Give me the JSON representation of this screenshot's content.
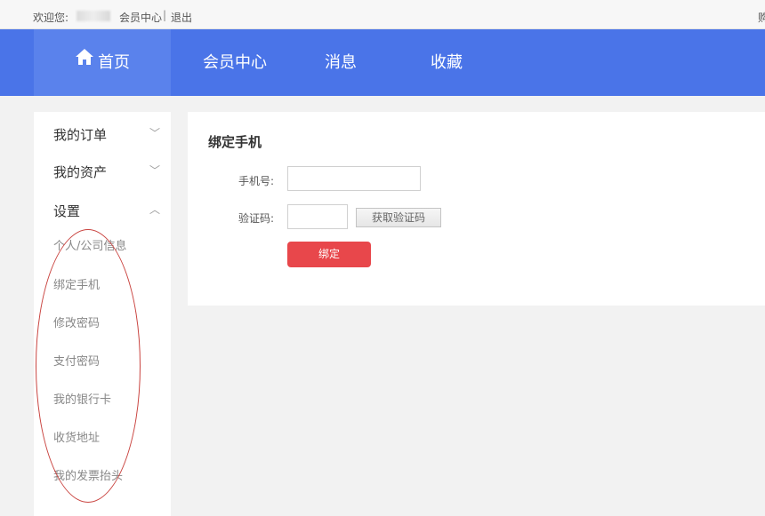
{
  "topbar": {
    "welcome": "欢迎您:",
    "member_center": "会员中心",
    "separator": "|",
    "logout": "退出",
    "cart_fragment": "购"
  },
  "nav": {
    "home": "首页",
    "member_center": "会员中心",
    "messages": "消息",
    "favorites": "收藏",
    "home_icon": "home-icon"
  },
  "sidebar": {
    "groups": [
      {
        "label": "我的订单",
        "state": "collapsed"
      },
      {
        "label": "我的资产",
        "state": "collapsed"
      },
      {
        "label": "设置",
        "state": "expanded"
      }
    ],
    "settings_items": [
      {
        "label": "个人/公司信息"
      },
      {
        "label": "绑定手机"
      },
      {
        "label": "修改密码"
      },
      {
        "label": "支付密码"
      },
      {
        "label": "我的银行卡"
      },
      {
        "label": "收货地址"
      },
      {
        "label": "我的发票抬头"
      }
    ]
  },
  "panel": {
    "title": "绑定手机",
    "phone_label": "手机号:",
    "phone_value": "",
    "code_label": "验证码:",
    "code_value": "",
    "get_code_button": "获取验证码",
    "bind_button": "绑定"
  },
  "colors": {
    "nav_bg": "#4a74e8",
    "nav_active": "#5a82ec",
    "bind_button": "#e8474b",
    "annotation_circle": "#c9433f"
  }
}
